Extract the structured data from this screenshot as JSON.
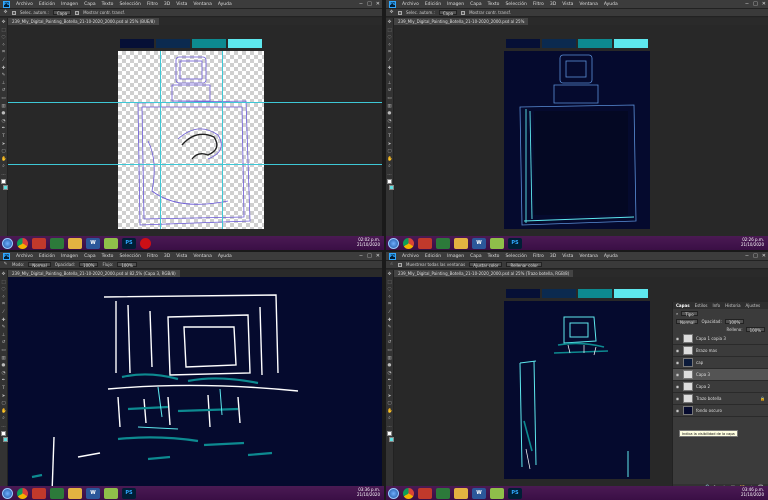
{
  "menu": [
    "Archivo",
    "Edición",
    "Imagen",
    "Capa",
    "Texto",
    "Selección",
    "Filtro",
    "3D",
    "Vista",
    "Ventana",
    "Ayuda"
  ],
  "app_logo": "Ps",
  "win_controls": [
    "−",
    "□",
    "✕"
  ],
  "opt_move": {
    "select_label": "Selec. autom.:",
    "select_value": "Capa",
    "transform_label": "Mostrar contr. transf."
  },
  "opt_brush": {
    "mode_label": "Modo:",
    "mode_value": "Normal",
    "opacity_label": "Opacidad:",
    "opacity_value": "100%",
    "flow_label": "Flujo:",
    "flow_value": "100%"
  },
  "opt_lasso": {
    "sample_label": "Muestrear todas las ventanas",
    "adjust_label": "Ajustar color",
    "clear_label": "Rellenar color"
  },
  "tabs": {
    "q1": "239_Mly_Digital_Painting_Botella_21-10-2020_2000.psd al 25% (BUE/8)",
    "q2": "239_Mly_Digital_Painting_Botella_21-10-2020_2000.psd al 25%",
    "q3": "239_Mly_Digital_Painting_Botella_21-10-2020_2000.psd al 82,5% (Capa 3, RGB/8)",
    "q4": "239_Mly_Digital_Painting_Botella_21-10-2020_2000.psd al 25% (Trazo botella, RGB/8)"
  },
  "status": {
    "q1_zoom": "25,00%",
    "q1_doc": "Doc: 34,7 M/88,2 M",
    "q2_zoom": "25,00%",
    "q2_doc": "Doc: 34,7 M/132,4 M",
    "q3_zoom": "82,44%",
    "q3_doc": "Doc: 34,7 M/132,3 M",
    "q4_zoom": "25,00%",
    "q4_doc": "Doc: 34,7 M/132,3 M"
  },
  "taskbar": {
    "apps": [
      "PS",
      "W",
      "PS"
    ],
    "top_left_time": "02:02 p.m.",
    "top_left_date": "21/10/2020",
    "top_right_time": "02:26 p.m.",
    "top_right_date": "21/10/2020",
    "bottom_left_time": "03:36 p.m.",
    "bottom_left_date": "21/10/2020",
    "bottom_right_time": "03:46 p.m.",
    "bottom_right_date": "21/10/2020"
  },
  "palette_colors": [
    "#061036",
    "#0b2a4f",
    "#0d8a90",
    "#5ee8ee"
  ],
  "layers_panel": {
    "tabs": [
      "Capas",
      "Estilos",
      "Info",
      "Historia",
      "Ajustes"
    ],
    "kind_label": "Tipo",
    "blend_value": "Normal",
    "opacity_label": "Opacidad:",
    "opacity_value": "100%",
    "fill_label": "Relleno:",
    "fill_value": "100%",
    "layers": [
      {
        "name": "Capa 1 copia 3",
        "thumb": "#ddd"
      },
      {
        "name": "Brazo mas",
        "thumb": "#ddd"
      },
      {
        "name": "cap",
        "thumb": "#0b1a3a"
      },
      {
        "name": "Capa 3",
        "thumb": "#ddd",
        "selected": true
      },
      {
        "name": "Capa 2",
        "thumb": "#ddd"
      },
      {
        "name": "Trazo botella",
        "thumb": "#ddd"
      },
      {
        "name": "fondo oscuro",
        "thumb": "#050a2e"
      }
    ],
    "tooltip": "Indica la visibilidad de la capa",
    "footer_icons": [
      "🔗",
      "fx",
      "◐",
      "▣",
      "📁",
      "+",
      "🗑"
    ]
  }
}
